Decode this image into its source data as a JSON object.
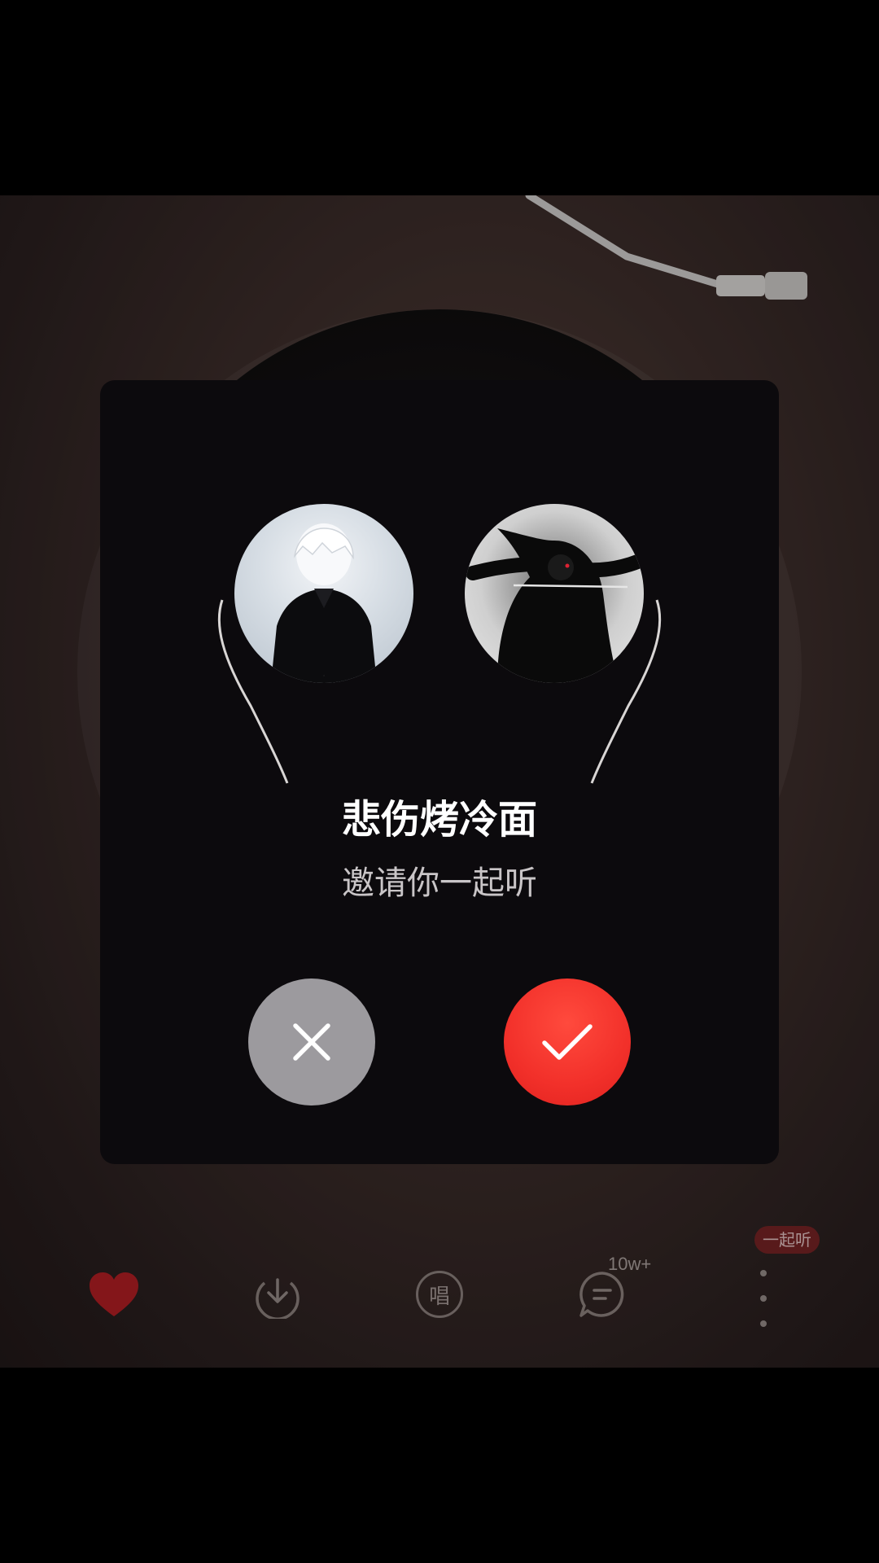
{
  "invite_dialog": {
    "inviter_name": "悲伤烤冷面",
    "invite_message": "邀请你一起听",
    "decline_button": "decline",
    "accept_button": "accept",
    "accent_color": "#f2302a"
  },
  "player_toolbar": {
    "comment_count": "10w+",
    "sing_label": "唱",
    "listen_together_badge": "一起听",
    "liked": true,
    "icons": [
      "heart-icon",
      "download-icon",
      "sing-icon",
      "comment-icon",
      "more-icon"
    ]
  }
}
